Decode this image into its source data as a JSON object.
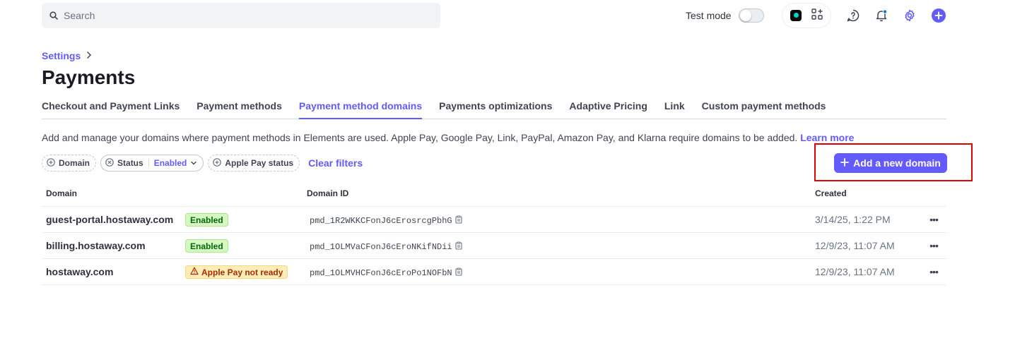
{
  "search": {
    "placeholder": "Search"
  },
  "topbar": {
    "test_mode_label": "Test mode",
    "test_mode_on": false,
    "icons": [
      "app-logo-icon",
      "apps-grid-icon",
      "help-icon",
      "bell-icon",
      "gear-icon",
      "plus-circle-icon"
    ]
  },
  "breadcrumb": {
    "settings": "Settings"
  },
  "page": {
    "title": "Payments"
  },
  "tabs": [
    {
      "label": "Checkout and Payment Links",
      "active": false
    },
    {
      "label": "Payment methods",
      "active": false
    },
    {
      "label": "Payment method domains",
      "active": true
    },
    {
      "label": "Payments optimizations",
      "active": false
    },
    {
      "label": "Adaptive Pricing",
      "active": false
    },
    {
      "label": "Link",
      "active": false
    },
    {
      "label": "Custom payment methods",
      "active": false
    }
  ],
  "description": {
    "text": "Add and manage your domains where payment methods in Elements are used. Apple Pay, Google Pay, Link, PayPal, Amazon Pay, and Klarna require domains to be added.",
    "link": "Learn more"
  },
  "filters": {
    "domain": "Domain",
    "status": "Status",
    "status_value": "Enabled",
    "apple_pay_status": "Apple Pay status",
    "clear": "Clear filters"
  },
  "actions": {
    "add_domain": "Add a new domain"
  },
  "table": {
    "headers": {
      "domain": "Domain",
      "domain_id": "Domain ID",
      "created": "Created"
    },
    "rows": [
      {
        "domain": "guest-portal.hostaway.com",
        "status": "Enabled",
        "status_type": "ok",
        "id": "pmd_1R2WKKCFonJ6cErosrcgPbhG",
        "created": "3/14/25, 1:22 PM"
      },
      {
        "domain": "billing.hostaway.com",
        "status": "Enabled",
        "status_type": "ok",
        "id": "pmd_1OLMVaCFonJ6cEroNKifNDii",
        "created": "12/9/23, 11:07 AM"
      },
      {
        "domain": "hostaway.com",
        "status": "Apple Pay not ready",
        "status_type": "warn",
        "id": "pmd_1OLMVHCFonJ6cEroPo1NOFbN",
        "created": "12/9/23, 11:07 AM"
      }
    ]
  },
  "colors": {
    "accent": "#635bff",
    "highlight": "#e00000"
  }
}
